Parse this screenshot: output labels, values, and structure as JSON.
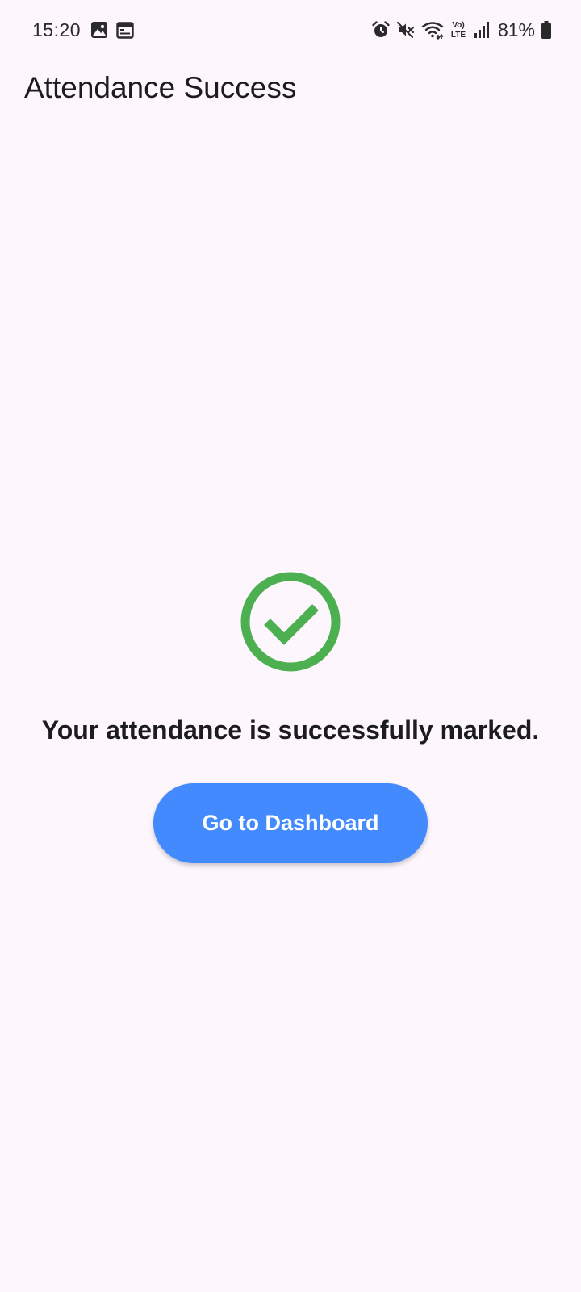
{
  "status_bar": {
    "time": "15:20",
    "battery_percent": "81%",
    "network_label": "LTE",
    "volte_label": "Vo)",
    "left_icons": [
      "gallery-icon",
      "calendar-icon"
    ],
    "right_icons": [
      "alarm-icon",
      "mute-icon",
      "wifi-icon",
      "volte-lte-icon",
      "signal-icon",
      "battery-icon"
    ],
    "battery_level": 0.81
  },
  "app_bar": {
    "title": "Attendance Success"
  },
  "main": {
    "icon": "check-circle-icon",
    "icon_color": "#4caf50",
    "message": "Your attendance is successfully marked.",
    "button_label": "Go to Dashboard",
    "button_color": "#448aff"
  }
}
